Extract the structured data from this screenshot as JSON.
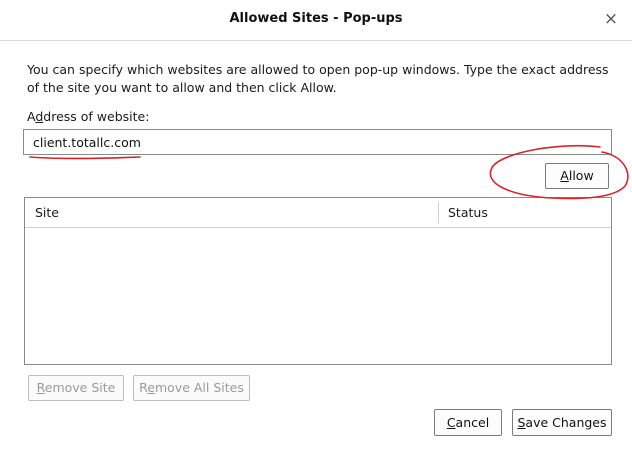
{
  "dialog": {
    "title": "Allowed Sites - Pop-ups",
    "close_glyph": "×",
    "description": "You can specify which websites are allowed to open pop-up windows. Type the exact address of the site you want to allow and then click Allow.",
    "address_label_prefix": "A",
    "address_label_key": "d",
    "address_label_suffix": "dress of website:",
    "address_value": "client.totallc.com",
    "allow_button": {
      "key": "A",
      "rest": "llow"
    },
    "table": {
      "columns": [
        "Site",
        "Status"
      ],
      "rows": []
    },
    "remove_site_button": {
      "key": "R",
      "rest": "emove Site"
    },
    "remove_all_button": {
      "prefix": "R",
      "key": "e",
      "rest": "move All Sites"
    },
    "cancel_button": {
      "key": "C",
      "rest": "ancel"
    },
    "save_button": {
      "key": "S",
      "rest": "ave Changes"
    }
  },
  "colors": {
    "annotation_red": "#d9232a",
    "border": "#8a8a8a",
    "disabled_text": "#9a9a9a"
  },
  "icons": {
    "close": "close-icon"
  }
}
